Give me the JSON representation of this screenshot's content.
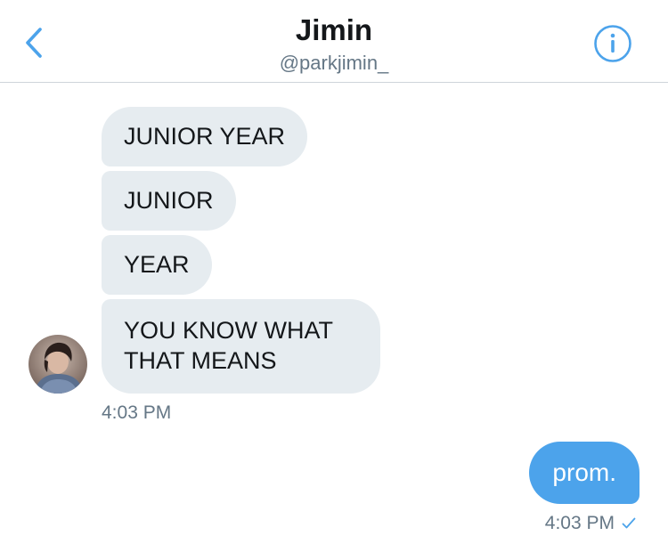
{
  "header": {
    "title": "Jimin",
    "handle": "@parkjimin_",
    "back_icon": "chevron-left-icon",
    "info_icon": "info-icon",
    "accent_color": "#4ca3eb"
  },
  "messages": {
    "received": [
      {
        "text": "JUNIOR YEAR"
      },
      {
        "text": "JUNIOR"
      },
      {
        "text": "YEAR"
      },
      {
        "text": "YOU KNOW WHAT THAT MEANS"
      }
    ],
    "received_time": "4:03 PM",
    "sent": [
      {
        "text": "prom."
      }
    ],
    "sent_time": "4:03 PM",
    "sent_status_icon": "checkmark-icon"
  }
}
